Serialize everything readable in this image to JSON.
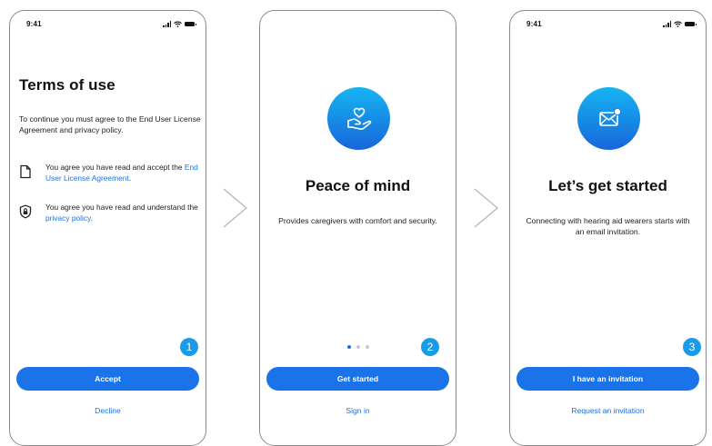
{
  "status": {
    "time": "9:41"
  },
  "screens": [
    {
      "title": "Terms of use",
      "intro": "To continue you must agree to the End User License Agreement and privacy policy.",
      "rows": [
        {
          "icon": "document-icon",
          "text_before": "You agree you have read and accept the ",
          "link_text": "End User License Agreement",
          "text_after": "."
        },
        {
          "icon": "lock-shield-icon",
          "text_before": "You agree you have read and understand the ",
          "link_text": "privacy policy",
          "text_after": "."
        }
      ],
      "step": "1",
      "primary_label": "Accept",
      "secondary_label": "Decline"
    },
    {
      "icon": "heart-hand-icon",
      "title": "Peace of mind",
      "text": "Provides caregivers with comfort and security.",
      "step": "2",
      "primary_label": "Get started",
      "secondary_label": "Sign in"
    },
    {
      "icon": "mail-notification-icon",
      "title": "Let’s get started",
      "text": "Connecting with hearing aid wearers starts with an email invitation.",
      "step": "3",
      "primary_label": "I have an invitation",
      "secondary_label": "Request an invitation"
    }
  ],
  "colors": {
    "accent": "#1a73e8",
    "badge": "#1a9be8",
    "gradient_top": "#16b5f3",
    "gradient_bottom": "#1766da"
  }
}
